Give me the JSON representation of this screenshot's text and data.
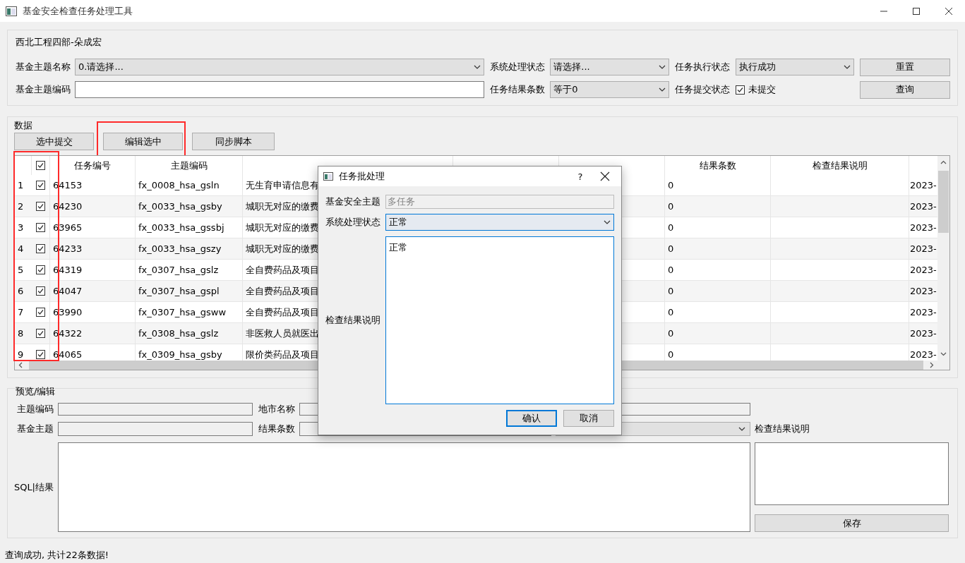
{
  "window": {
    "title": "基金安全检查任务处理工具"
  },
  "filter": {
    "title": "西北工程四部-朵成宏",
    "topic_name": {
      "label": "基金主题名称",
      "value": "0.请选择..."
    },
    "system_status": {
      "label": "系统处理状态",
      "value": "请选择..."
    },
    "exec_status": {
      "label": "任务执行状态",
      "value": "执行成功"
    },
    "topic_code": {
      "label": "基金主题编码"
    },
    "result_count": {
      "label": "任务结果条数",
      "value": "等于0"
    },
    "submit_status": {
      "label": "任务提交状态",
      "option": "未提交",
      "checked": true
    },
    "buttons": [
      "重置",
      "查询"
    ]
  },
  "data": {
    "title": "数据",
    "buttons": [
      {
        "label": "选中提交",
        "highlighted": false
      },
      {
        "label": "编辑选中",
        "highlighted": true
      },
      {
        "label": "同步脚本",
        "highlighted": false
      }
    ],
    "table": {
      "select_all_checked": true,
      "checkbox_column_highlighted": true,
      "columns": [
        "任务编号",
        "主题编码",
        null,
        null,
        null,
        "结果条数",
        "检查结果说明"
      ],
      "rows": [
        {
          "number": "1",
          "checked": true,
          "task_id": "64153",
          "topic_code": "fx_0008_hsa_gsln",
          "topic_name": "无生育申请信息有",
          "result_count": "0",
          "column_10": "2023-"
        },
        {
          "number": "2",
          "checked": true,
          "task_id": "64230",
          "topic_code": "fx_0033_hsa_gsby",
          "topic_name": "城职无对应的缴费",
          "result_count": "0",
          "column_10": "2023-"
        },
        {
          "number": "3",
          "checked": true,
          "task_id": "63965",
          "topic_code": "fx_0033_hsa_gssbj",
          "topic_name": "城职无对应的缴费",
          "result_count": "0",
          "column_10": "2023-"
        },
        {
          "number": "4",
          "checked": true,
          "task_id": "64233",
          "topic_code": "fx_0033_hsa_gszy",
          "topic_name": "城职无对应的缴费",
          "result_count": "0",
          "column_10": "2023-"
        },
        {
          "number": "5",
          "checked": true,
          "task_id": "64319",
          "topic_code": "fx_0307_hsa_gslz",
          "topic_name": "全自费药品及项目",
          "result_count": "0",
          "column_10": "2023-"
        },
        {
          "number": "6",
          "checked": true,
          "task_id": "64047",
          "topic_code": "fx_0307_hsa_gspl",
          "topic_name": "全自费药品及项目",
          "result_count": "0",
          "column_10": "2023-"
        },
        {
          "number": "7",
          "checked": true,
          "task_id": "63990",
          "topic_code": "fx_0307_hsa_gsww",
          "topic_name": "全自费药品及项目",
          "result_count": "0",
          "column_10": "2023-"
        },
        {
          "number": "8",
          "checked": true,
          "task_id": "64322",
          "topic_code": "fx_0308_hsa_gslz",
          "topic_name": "非医救人员就医出",
          "result_count": "0",
          "column_10": "2023-"
        },
        {
          "number": "9",
          "checked": true,
          "task_id": "64065",
          "topic_code": "fx_0309_hsa_gsby",
          "topic_name": "限价类药品及项目",
          "result_count": "0",
          "column_10": "2023-"
        }
      ]
    }
  },
  "preview": {
    "title": "预览/编辑",
    "topic_code_label": "主题编码",
    "city_label": "地市名称",
    "fund_topic_label": "基金主题",
    "result_count_label": "结果条数",
    "sql_label": "SQL|结果",
    "explanation_label": "检查结果说明",
    "save_button": "保存"
  },
  "dialog": {
    "title": "任务批处理",
    "help": "?",
    "fund_topic": {
      "label": "基金安全主题",
      "value": "多任务",
      "disabled": true
    },
    "system_status": {
      "label": "系统处理状态",
      "value": "正常"
    },
    "explanation": {
      "label": "检查结果说明",
      "value": "正常"
    },
    "buttons": [
      {
        "label": "确认",
        "default": true
      },
      {
        "label": "取消",
        "default": false
      }
    ]
  },
  "status_bar": "查询成功, 共计22条数据!"
}
